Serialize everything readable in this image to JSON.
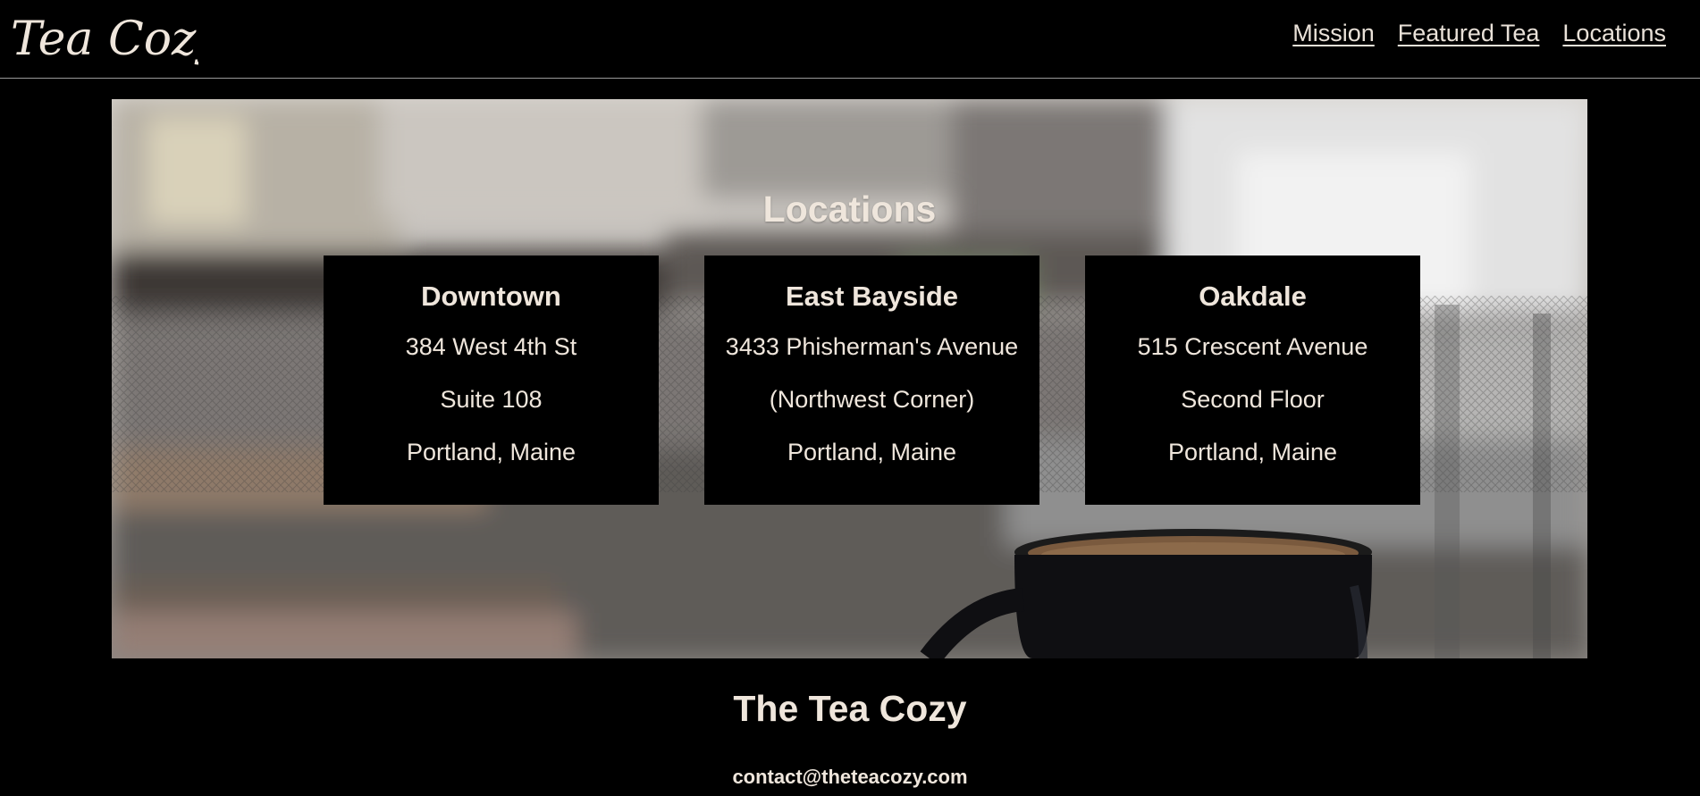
{
  "header": {
    "logo_text": "Tea Cozy",
    "nav": [
      {
        "label": "Mission"
      },
      {
        "label": "Featured Tea"
      },
      {
        "label": "Locations"
      }
    ]
  },
  "hero": {
    "title": "Locations",
    "locations": [
      {
        "name": "Downtown",
        "lines": [
          "384 West 4th St",
          "Suite 108",
          "Portland, Maine"
        ]
      },
      {
        "name": "East Bayside",
        "lines": [
          "3433 Phisherman's Avenue",
          "(Northwest Corner)",
          "Portland, Maine"
        ]
      },
      {
        "name": "Oakdale",
        "lines": [
          "515 Crescent Avenue",
          "Second Floor",
          "Portland, Maine"
        ]
      }
    ]
  },
  "footer": {
    "title": "The Tea Cozy",
    "email": "contact@theteacozy.com"
  },
  "colors": {
    "background": "#000000",
    "text": "#efe6dc",
    "card": "#000000"
  },
  "icons": {
    "logo": "tea-cozy-script-logo"
  }
}
